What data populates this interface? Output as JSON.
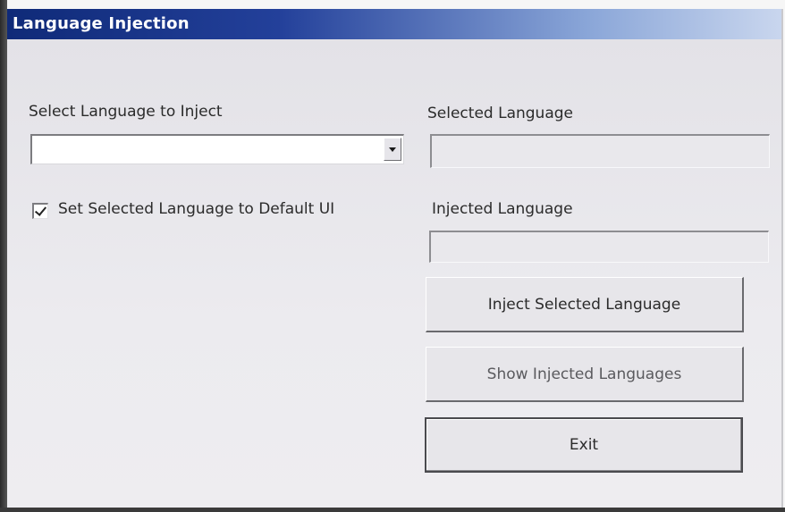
{
  "window": {
    "title": "Language Injection"
  },
  "form": {
    "select_language_label": "Select Language to Inject",
    "select_language_value": "",
    "default_ui_checkbox_label": "Set Selected Language to Default UI",
    "default_ui_checked": true,
    "selected_language_label": "Selected Language",
    "selected_language_value": "",
    "injected_language_label": "Injected Language",
    "injected_language_value": ""
  },
  "buttons": {
    "inject_label": "Inject Selected Language",
    "show_injected_label": "Show Injected Languages",
    "exit_label": "Exit"
  },
  "colors": {
    "titlebar_start": "#0f2a78",
    "titlebar_end": "#c9d6ee",
    "window_face": "#e9e8ec"
  }
}
